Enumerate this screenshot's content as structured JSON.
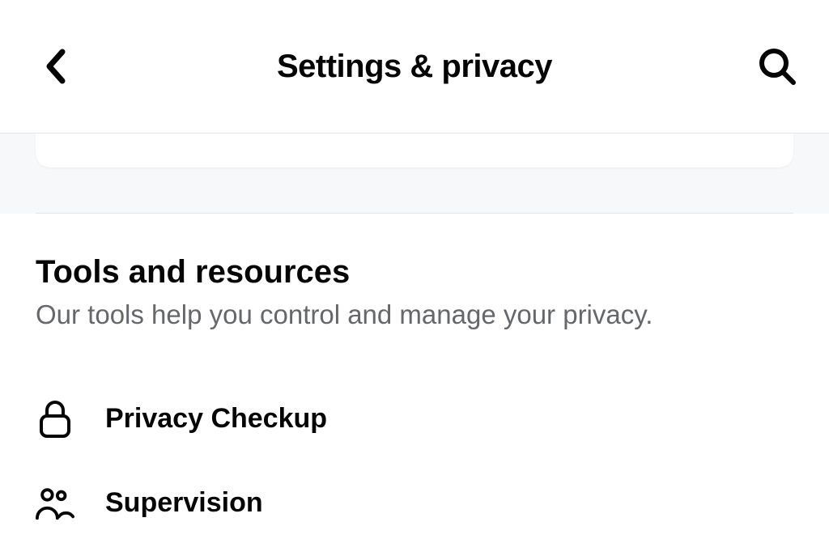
{
  "header": {
    "title": "Settings & privacy"
  },
  "section": {
    "title": "Tools and resources",
    "subtitle": "Our tools help you control and manage your privacy."
  },
  "rows": [
    {
      "label": "Privacy Checkup",
      "icon": "lock-icon"
    },
    {
      "label": "Supervision",
      "icon": "people-icon"
    }
  ]
}
